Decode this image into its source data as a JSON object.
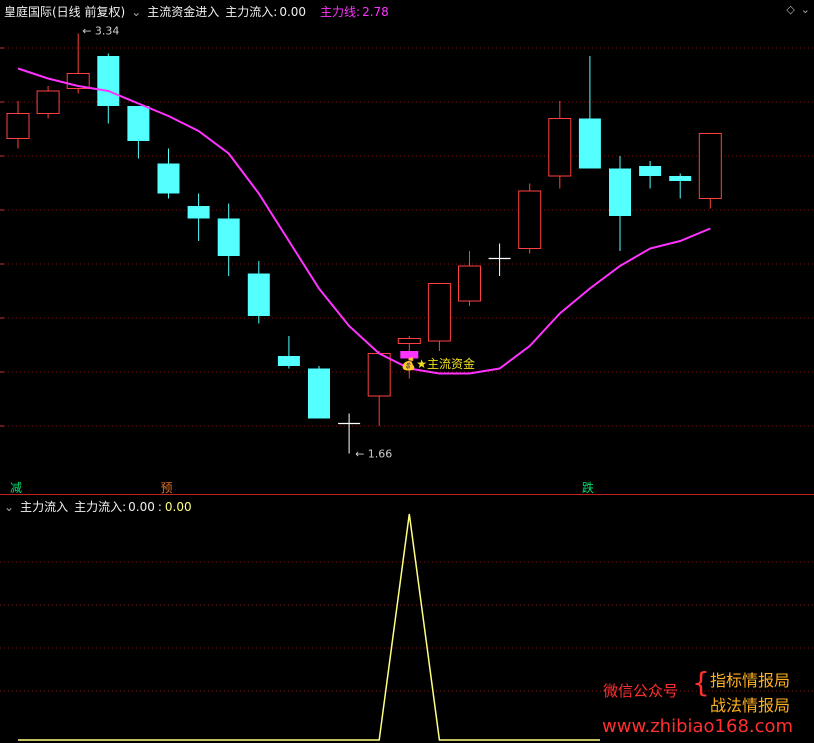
{
  "header": {
    "stock_name": "皇庭国际(日线 前复权)",
    "indicator_name": "主流资金进入",
    "inflow_label": "主力流入:",
    "inflow_value": "0.00",
    "line_label": "主力线:",
    "line_value": "2.78"
  },
  "lower_header": {
    "indicator_name": "主力流入",
    "label": "主力流入:",
    "value_a": "0.00",
    "separator": ":",
    "value_b": "0.00"
  },
  "annotations": {
    "high_label": "3.34",
    "low_label": "1.66",
    "signal_label": "主流资金"
  },
  "markers": [
    {
      "text": "减",
      "color": "#00e070",
      "candle": 0
    },
    {
      "text": "预",
      "color": "#e07030",
      "candle": 5
    },
    {
      "text": "跌",
      "color": "#00e070",
      "candle": 19
    }
  ],
  "watermark": {
    "wechat": "微信公众号",
    "line1": "指标情报局",
    "line2": "战法情报局",
    "url": "www.zhibiao168.com"
  },
  "colors": {
    "up": "#ff4040",
    "down": "#54ffff",
    "ma": "#ff33ff",
    "signal": "#ff33ff",
    "grid": "#7a1515",
    "flow": "#ffff80",
    "neutral": "#ffffff"
  },
  "chart_data": {
    "type": "candlestick",
    "price_range": [
      1.6,
      3.4
    ],
    "candles": [
      {
        "o": 2.92,
        "h": 3.07,
        "l": 2.88,
        "c": 3.02
      },
      {
        "o": 3.02,
        "h": 3.13,
        "l": 3.0,
        "c": 3.11
      },
      {
        "o": 3.12,
        "h": 3.34,
        "l": 3.1,
        "c": 3.18
      },
      {
        "o": 3.25,
        "h": 3.26,
        "l": 2.98,
        "c": 3.05
      },
      {
        "o": 3.05,
        "h": 3.05,
        "l": 2.84,
        "c": 2.91
      },
      {
        "o": 2.82,
        "h": 2.88,
        "l": 2.68,
        "c": 2.7
      },
      {
        "o": 2.65,
        "h": 2.7,
        "l": 2.51,
        "c": 2.6
      },
      {
        "o": 2.6,
        "h": 2.66,
        "l": 2.37,
        "c": 2.45
      },
      {
        "o": 2.38,
        "h": 2.43,
        "l": 2.18,
        "c": 2.21
      },
      {
        "o": 2.05,
        "h": 2.13,
        "l": 2.0,
        "c": 2.01
      },
      {
        "o": 2.0,
        "h": 2.01,
        "l": 1.8,
        "c": 1.8
      },
      {
        "o": 1.78,
        "h": 1.82,
        "l": 1.66,
        "c": 1.78
      },
      {
        "o": 1.89,
        "h": 2.07,
        "l": 1.77,
        "c": 2.06
      },
      {
        "o": 2.1,
        "h": 2.13,
        "l": 1.96,
        "c": 2.12
      },
      {
        "o": 2.11,
        "h": 2.31,
        "l": 2.07,
        "c": 2.34
      },
      {
        "o": 2.27,
        "h": 2.47,
        "l": 2.25,
        "c": 2.41
      },
      {
        "o": 2.44,
        "h": 2.5,
        "l": 2.37,
        "c": 2.44
      },
      {
        "o": 2.48,
        "h": 2.74,
        "l": 2.46,
        "c": 2.71
      },
      {
        "o": 2.77,
        "h": 3.07,
        "l": 2.72,
        "c": 3.0
      },
      {
        "o": 3.0,
        "h": 3.25,
        "l": 2.82,
        "c": 2.8
      },
      {
        "o": 2.8,
        "h": 2.85,
        "l": 2.47,
        "c": 2.61
      },
      {
        "o": 2.81,
        "h": 2.83,
        "l": 2.72,
        "c": 2.77
      },
      {
        "o": 2.77,
        "h": 2.78,
        "l": 2.68,
        "c": 2.75
      },
      {
        "o": 2.68,
        "h": 2.94,
        "l": 2.64,
        "c": 2.94
      }
    ],
    "ma": [
      3.2,
      3.16,
      3.13,
      3.11,
      3.06,
      3.01,
      2.95,
      2.86,
      2.7,
      2.51,
      2.32,
      2.17,
      2.06,
      2.0,
      1.98,
      1.98,
      2.0,
      2.09,
      2.22,
      2.32,
      2.41,
      2.48,
      2.51,
      2.56
    ],
    "signal_candle": 13,
    "signal_box": {
      "o": 2.07,
      "c": 2.04
    },
    "flow": [
      0,
      0,
      0,
      0,
      0,
      0,
      0,
      0,
      0,
      0,
      0,
      0,
      0,
      0,
      1,
      0,
      0,
      0,
      0,
      0,
      0,
      0,
      0,
      0
    ],
    "flow_peak_candle": 13
  }
}
